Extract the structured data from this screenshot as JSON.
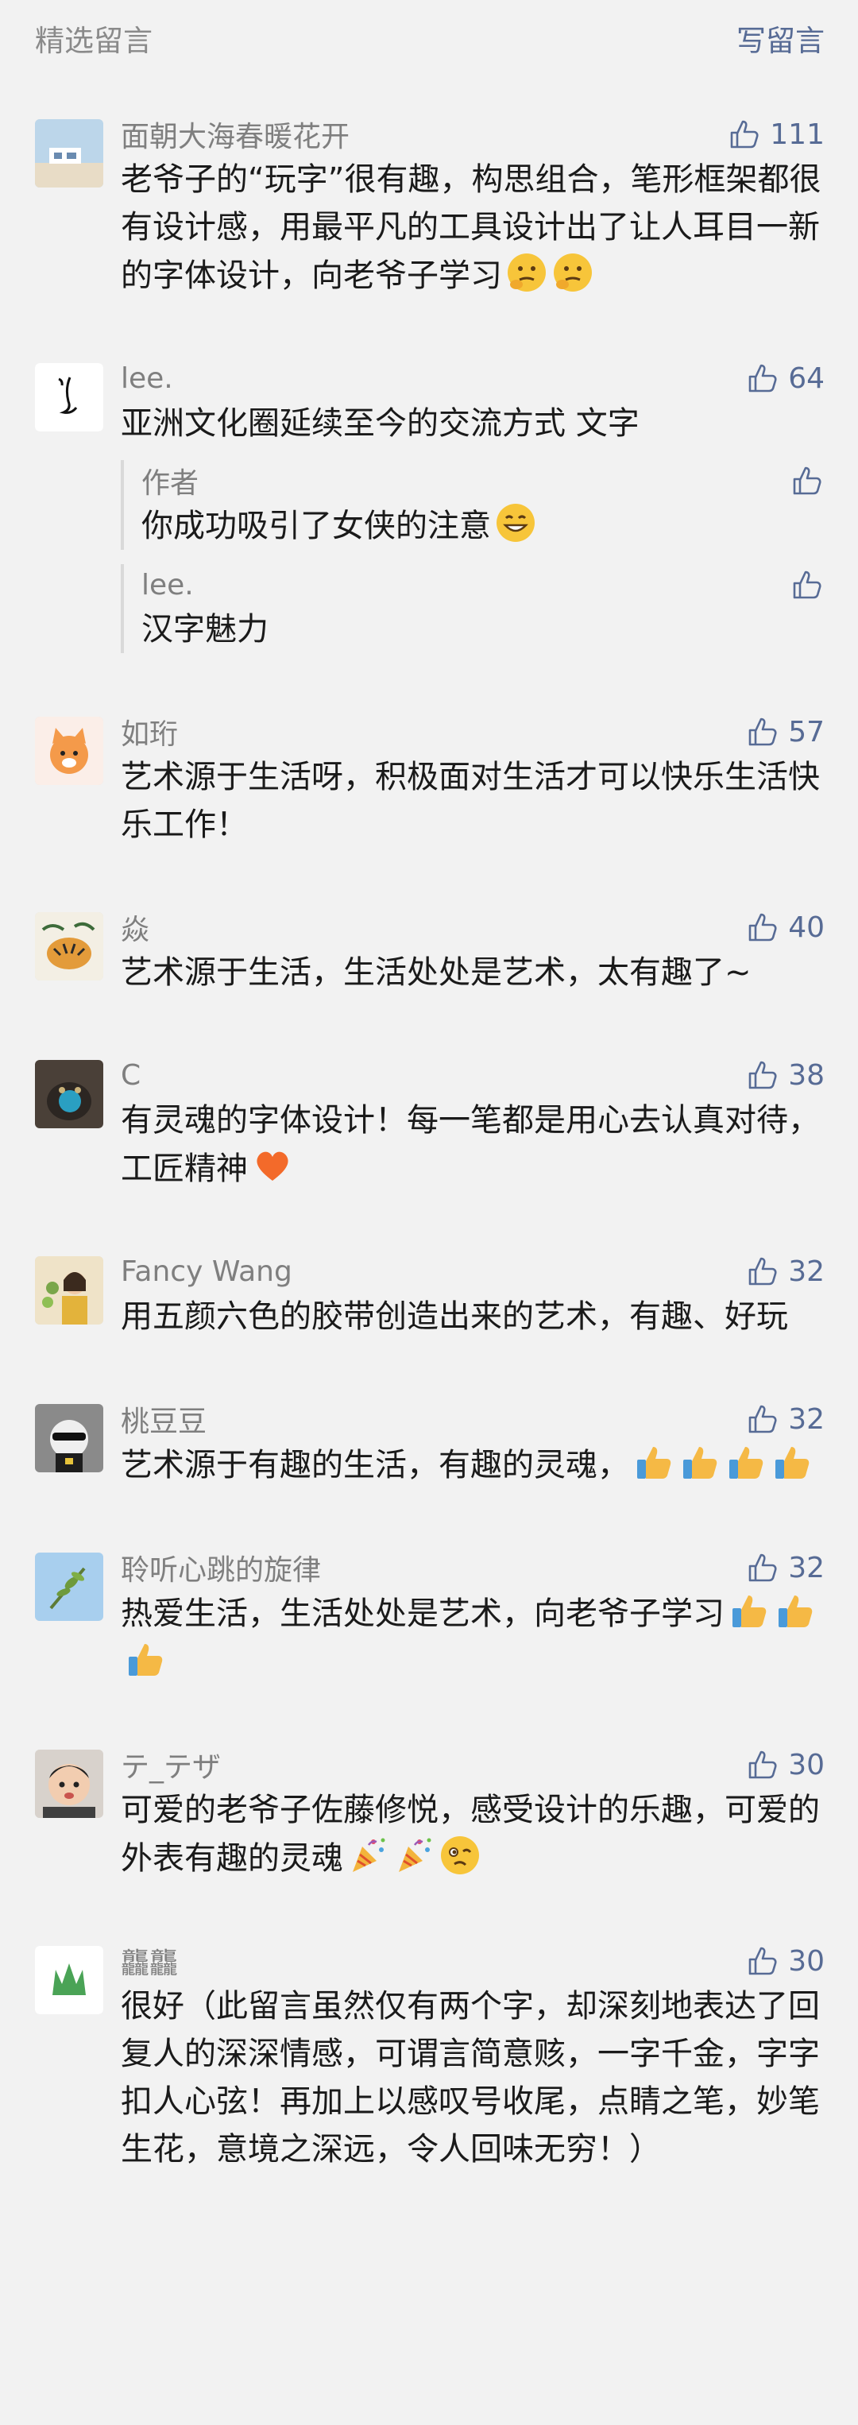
{
  "header": {
    "title": "精选留言",
    "action": "写留言"
  },
  "comments": [
    {
      "nickname": "面朝大海春暖花开",
      "likes": "111",
      "avatar_icon": "beach-house-avatar",
      "content": "老爷子的“玩字”很有趣，构思组合，笔形框架都很有设计感，用最平凡的工具设计出了让人耳目一新的字体设计，向老爷子学习",
      "emojis": [
        "thinking-face-emoji",
        "thinking-face-emoji"
      ]
    },
    {
      "nickname": "lee.",
      "likes": "64",
      "avatar_icon": "calligraphy-avatar",
      "content": "亚洲文化圈延续至今的交流方式 文字",
      "replies": [
        {
          "nickname": "作者",
          "content": "你成功吸引了女侠的注意",
          "emoji": "grinning-face-emoji"
        },
        {
          "nickname": "lee.",
          "content": "汉字魅力"
        }
      ]
    },
    {
      "nickname": "如珩",
      "likes": "57",
      "avatar_icon": "cartoon-cat-avatar",
      "content": "艺术源于生活呀，积极面对生活才可以快乐生活快乐工作！"
    },
    {
      "nickname": "焱",
      "likes": "40",
      "avatar_icon": "tiger-painting-avatar",
      "content": "艺术源于生活，生活处处是艺术，太有趣了~"
    },
    {
      "nickname": "C",
      "likes": "38",
      "avatar_icon": "dark-cat-avatar",
      "content": "有灵魂的字体设计！每一笔都是用心去认真对待，工匠精神",
      "emojis": [
        "orange-heart-emoji"
      ]
    },
    {
      "nickname": "Fancy Wang",
      "likes": "32",
      "avatar_icon": "girl-flowers-avatar",
      "content": "用五颜六色的胶带创造出来的艺术，有趣、好玩"
    },
    {
      "nickname": "桃豆豆",
      "likes": "32",
      "avatar_icon": "dog-sunglasses-avatar",
      "content": "艺术源于有趣的生活，有趣的灵魂，",
      "emojis": [
        "thumbs-up-emoji",
        "thumbs-up-emoji",
        "thumbs-up-emoji",
        "thumbs-up-emoji"
      ]
    },
    {
      "nickname": "聆听心跳的旋律",
      "likes": "32",
      "avatar_icon": "sky-branch-avatar",
      "content": "热爱生活，生活处处是艺术，向老爷子学习",
      "emojis": [
        "thumbs-up-emoji",
        "thumbs-up-emoji",
        "thumbs-up-emoji"
      ]
    },
    {
      "nickname": "テ_テザ",
      "likes": "30",
      "avatar_icon": "baby-avatar",
      "content": "可爱的老爷子佐藤修悦，感受设计的乐趣，可爱的外表有趣的灵魂",
      "emojis": [
        "party-popper-emoji",
        "party-popper-emoji",
        "woozy-face-emoji"
      ]
    },
    {
      "nickname": "龘龘",
      "likes": "30",
      "avatar_icon": "grass-logo-avatar",
      "content": "很好（此留言虽然仅有两个字，却深刻地表达了回复人的深深情感，可谓言简意赅，一字千金，字字扣人心弦！再加上以感叹号收尾，点睛之笔，妙笔生花，意境之深远，令人回味无穷！）"
    }
  ],
  "colors": {
    "background": "#f2f2f2",
    "link": "#576b95",
    "nickname": "#7f7f7f",
    "text": "#1a1a1a"
  }
}
